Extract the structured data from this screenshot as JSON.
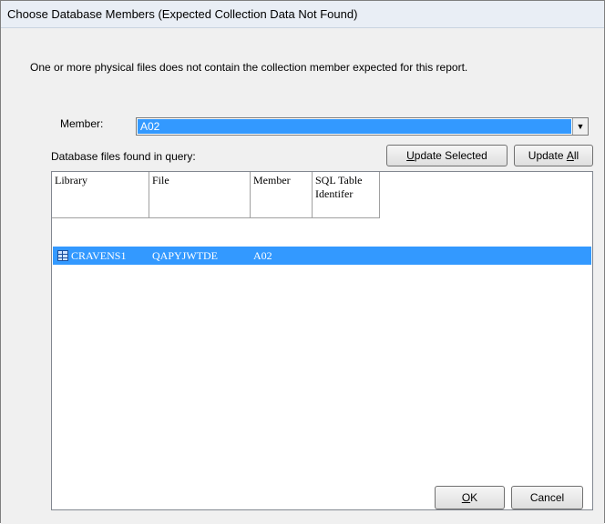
{
  "window": {
    "title": "Choose Database Members (Expected Collection Data Not Found)"
  },
  "info_text": "One or more physical files does not contain the collection member expected for this report.",
  "member": {
    "label": "Member:",
    "value": "A02"
  },
  "files_label": "Database files found in query:",
  "buttons": {
    "update_selected_u": "U",
    "update_selected_rest": "pdate Selected",
    "update_all_pre": "Update ",
    "update_all_u": "A",
    "update_all_rest": "ll",
    "ok_u": "O",
    "ok_rest": "K",
    "cancel": "Cancel"
  },
  "table": {
    "columns": [
      "Library",
      "File",
      "Member",
      "SQL Table Identifer"
    ],
    "rows": [
      {
        "library": "CRAVENS1",
        "file": "QAPYJWTDE",
        "member": "A02",
        "sql": ""
      }
    ]
  },
  "icons": {
    "dropdown": "chevron-down-icon",
    "row": "table-icon"
  }
}
